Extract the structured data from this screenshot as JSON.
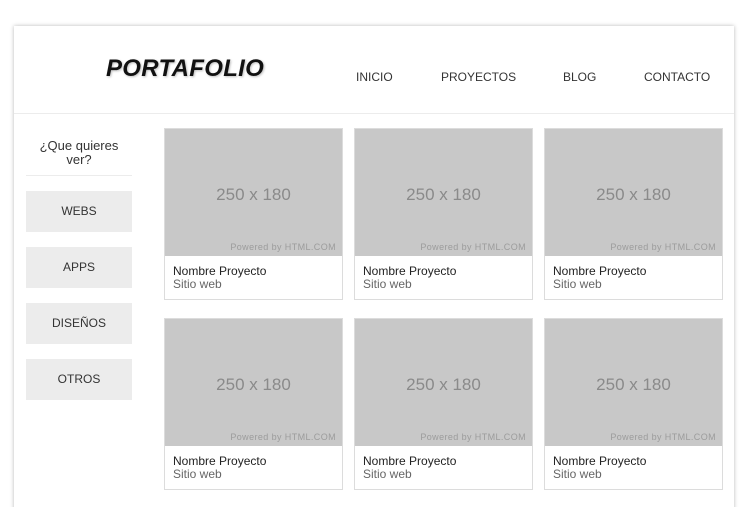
{
  "header": {
    "logo": "PORTAFOLIO",
    "nav": [
      "INICIO",
      "PROYECTOS",
      "BLOG",
      "CONTACTO"
    ]
  },
  "sidebar": {
    "question": "¿Que quieres ver?",
    "filters": [
      "WEBS",
      "APPS",
      "DISEÑOS",
      "OTROS"
    ]
  },
  "projects": [
    {
      "placeholder": "250 x 180",
      "watermark": "Powered by HTML.COM",
      "title": "Nombre Proyecto",
      "type": "Sitio web"
    },
    {
      "placeholder": "250 x 180",
      "watermark": "Powered by HTML.COM",
      "title": "Nombre Proyecto",
      "type": "Sitio web"
    },
    {
      "placeholder": "250 x 180",
      "watermark": "Powered by HTML.COM",
      "title": "Nombre Proyecto",
      "type": "Sitio web"
    },
    {
      "placeholder": "250 x 180",
      "watermark": "Powered by HTML.COM",
      "title": "Nombre Proyecto",
      "type": "Sitio web"
    },
    {
      "placeholder": "250 x 180",
      "watermark": "Powered by HTML.COM",
      "title": "Nombre Proyecto",
      "type": "Sitio web"
    },
    {
      "placeholder": "250 x 180",
      "watermark": "Powered by HTML.COM",
      "title": "Nombre Proyecto",
      "type": "Sitio web"
    }
  ]
}
